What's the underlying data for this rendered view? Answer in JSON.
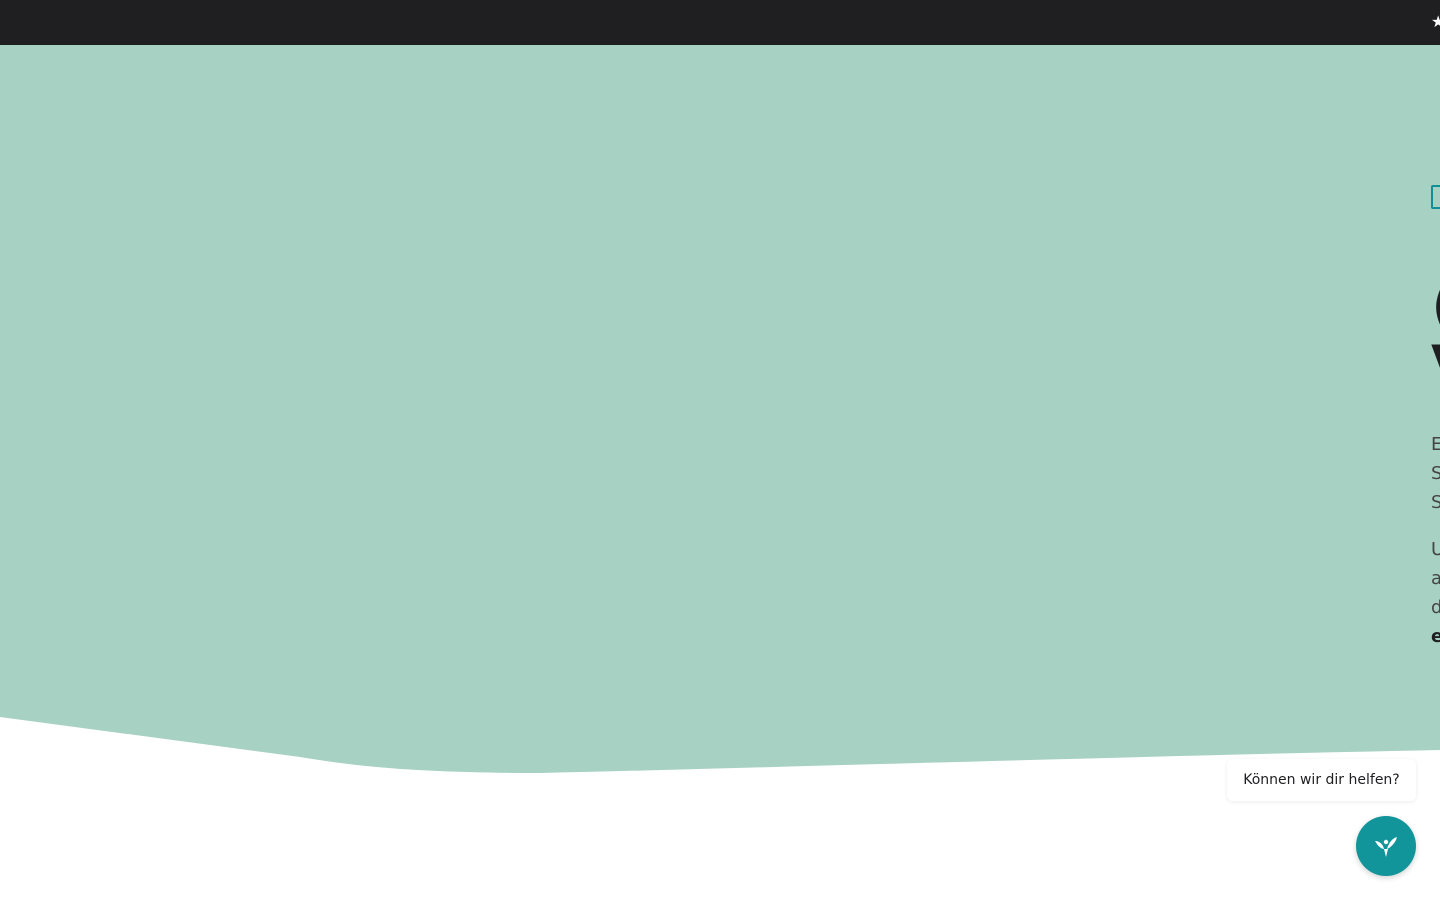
{
  "topbar": {
    "star_icon": "star-icon",
    "star_glyph": "★"
  },
  "colors": {
    "topbar_background": "#1f1e21",
    "hero_background": "#a6d1c3",
    "accent": "#11959b",
    "page_background": "#ffffff"
  },
  "hero": {
    "eyebrow_icon": "tag-outline-icon",
    "title": "(\nV",
    "paragraph_1": "E\nS\nS",
    "paragraph_2": "U\na\nd",
    "paragraph_2_bold": "e"
  },
  "help_widget": {
    "bubble_text": "Können wir dir helfen?",
    "button_icon": "leaf-person-icon"
  }
}
